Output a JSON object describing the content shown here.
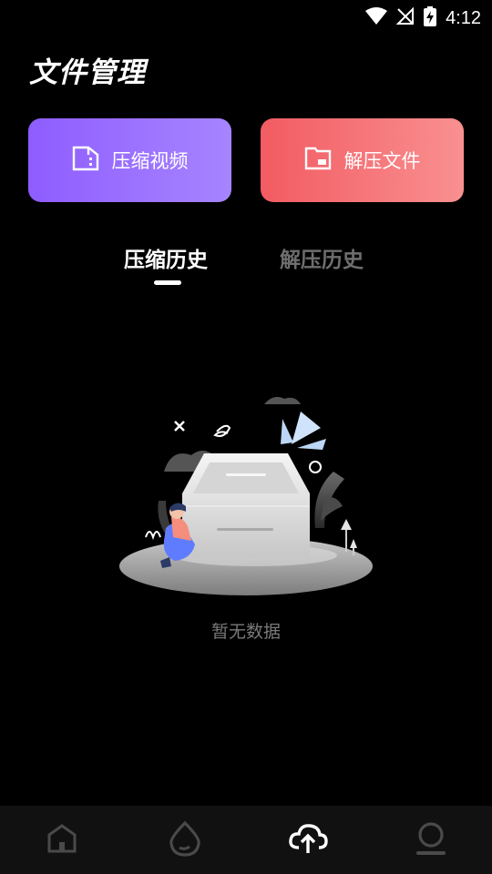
{
  "status_bar": {
    "time": "4:12"
  },
  "header": {
    "title": "文件管理"
  },
  "actions": {
    "compress_video": "压缩视频",
    "extract_files": "解压文件"
  },
  "tabs": {
    "compress_history": "压缩历史",
    "extract_history": "解压历史",
    "active": "压缩历史"
  },
  "empty_state": {
    "message": "暂无数据"
  },
  "bottom_nav": {
    "items": [
      {
        "icon": "home-icon",
        "active": false
      },
      {
        "icon": "drop-icon",
        "active": false
      },
      {
        "icon": "cloud-upload-icon",
        "active": true
      },
      {
        "icon": "profile-icon",
        "active": false
      }
    ]
  },
  "colors": {
    "background": "#000000",
    "compress_gradient": [
      "#8f5cff",
      "#a685ff"
    ],
    "extract_gradient": [
      "#f25b62",
      "#f99090"
    ],
    "inactive_tab": "#6e6e6e",
    "nav_bg": "#111111"
  }
}
